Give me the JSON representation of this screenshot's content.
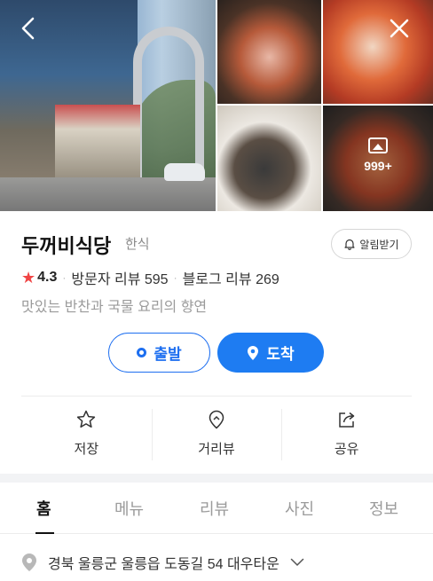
{
  "gallery": {
    "more_count": "999+"
  },
  "place": {
    "name": "두꺼비식당",
    "category": "한식",
    "notify_label": "알림받기",
    "rating": "4.3",
    "visitor_reviews": "방문자 리뷰 595",
    "blog_reviews": "블로그 리뷰 269",
    "tagline": "맛있는 반찬과 국물 요리의 향연"
  },
  "buttons": {
    "depart": "출발",
    "arrive": "도착"
  },
  "actions": [
    {
      "label": "저장",
      "icon": "star-outline-icon"
    },
    {
      "label": "거리뷰",
      "icon": "location-pin-outline-icon"
    },
    {
      "label": "공유",
      "icon": "share-icon"
    }
  ],
  "tabs": [
    {
      "label": "홈",
      "active": true
    },
    {
      "label": "메뉴",
      "active": false
    },
    {
      "label": "리뷰",
      "active": false
    },
    {
      "label": "사진",
      "active": false
    },
    {
      "label": "정보",
      "active": false
    }
  ],
  "address": "경북 울릉군 울릉읍 도동길 54 대우타운",
  "colors": {
    "primary": "#1e7cf2",
    "star": "#f04444",
    "muted": "#9b9b9b"
  }
}
